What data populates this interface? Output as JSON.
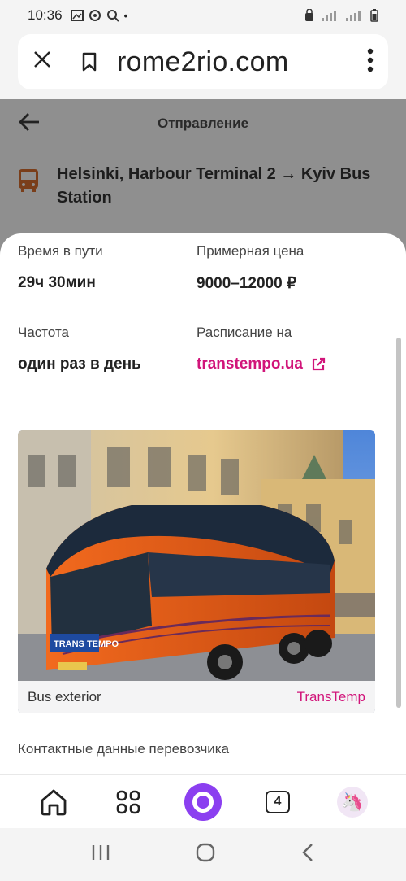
{
  "status_bar": {
    "time": "10:36"
  },
  "browser": {
    "url": "rome2rio.com",
    "tab_count": "4"
  },
  "page": {
    "title": "Отправление",
    "route": "Helsinki, Harbour Terminal 2 → Kyiv Bus Station"
  },
  "details": {
    "duration_label": "Время в пути",
    "duration_value": "29ч 30мин",
    "price_label": "Примерная цена",
    "price_value": "9000–12000 ₽",
    "frequency_label": "Частота",
    "frequency_value": "один раз в день",
    "schedule_label": "Расписание на",
    "schedule_link": "transtempo.ua"
  },
  "photo": {
    "caption": "Bus exterior",
    "credit": "TransTemp",
    "bus_brand": "TRANS TEMPO"
  },
  "contact_label": "Контактные данные перевозчика",
  "colors": {
    "accent": "#d1157a",
    "bus_orange": "#e8561a",
    "alice_purple": "#8b3ff0"
  }
}
